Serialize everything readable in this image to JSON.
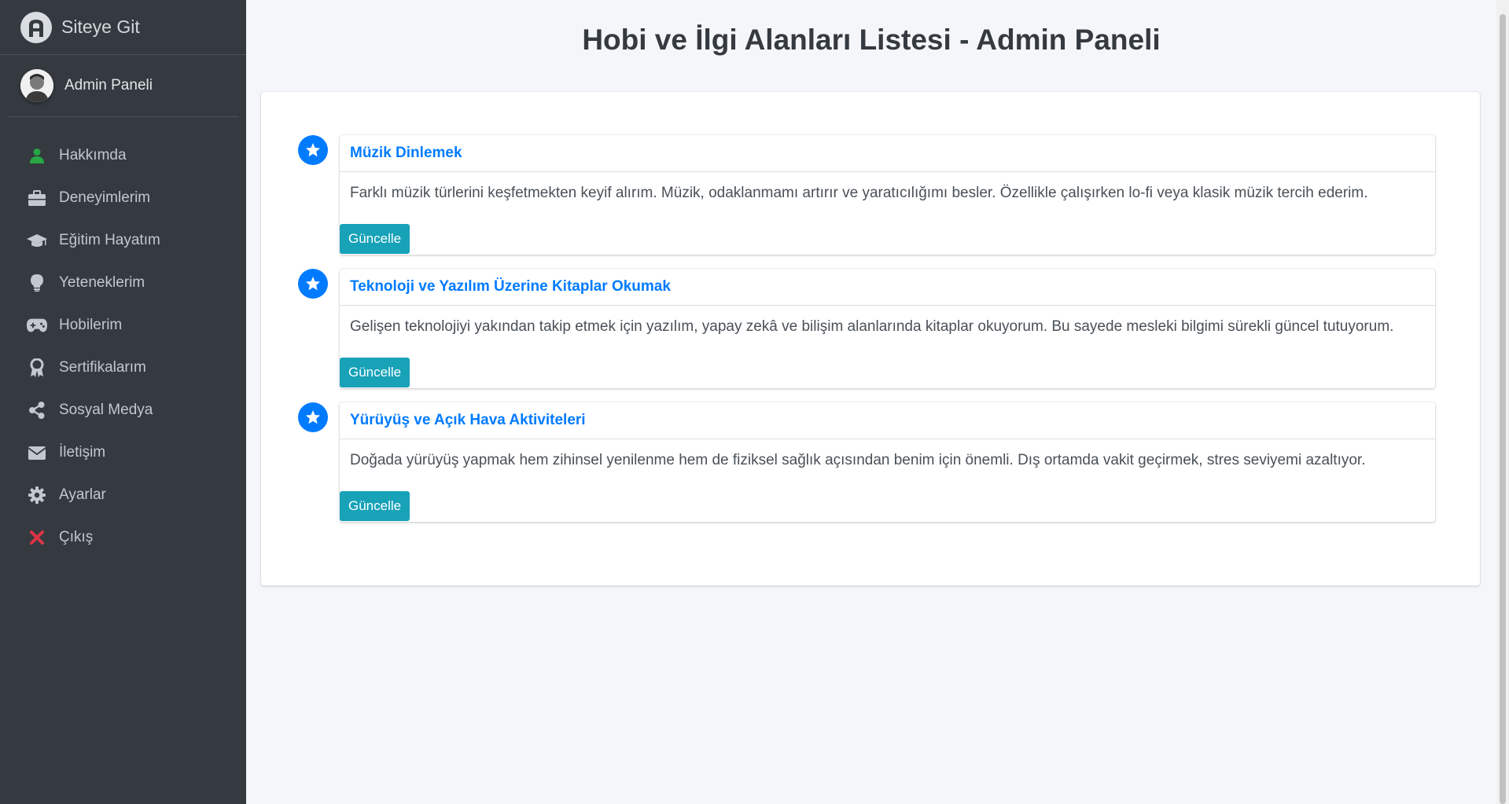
{
  "sidebar": {
    "brand": "Siteye Git",
    "user": "Admin Paneli",
    "items": [
      {
        "label": "Hakkımda",
        "icon": "user-icon",
        "color": "#28a745"
      },
      {
        "label": "Deneyimlerim",
        "icon": "briefcase-icon",
        "color": "#c2c7d0"
      },
      {
        "label": "Eğitim Hayatım",
        "icon": "graduation-cap-icon",
        "color": "#c2c7d0"
      },
      {
        "label": "Yeteneklerim",
        "icon": "lightbulb-icon",
        "color": "#c2c7d0"
      },
      {
        "label": "Hobilerim",
        "icon": "gamepad-icon",
        "color": "#c2c7d0"
      },
      {
        "label": "Sertifikalarım",
        "icon": "award-icon",
        "color": "#c2c7d0"
      },
      {
        "label": "Sosyal Medya",
        "icon": "share-icon",
        "color": "#c2c7d0"
      },
      {
        "label": "İletişim",
        "icon": "envelope-icon",
        "color": "#c2c7d0"
      },
      {
        "label": "Ayarlar",
        "icon": "gear-icon",
        "color": "#c2c7d0"
      },
      {
        "label": "Çıkış",
        "icon": "close-icon",
        "color": "#dc3545"
      }
    ]
  },
  "main": {
    "title": "Hobi ve İlgi Alanları Listesi - Admin Paneli",
    "hobbies": [
      {
        "title": "Müzik Dinlemek",
        "description": "Farklı müzik türlerini keşfetmekten keyif alırım. Müzik, odaklanmamı artırır ve yaratıcılığımı besler. Özellikle çalışırken lo-fi veya klasik müzik tercih ederim.",
        "button": "Güncelle"
      },
      {
        "title": "Teknoloji ve Yazılım Üzerine Kitaplar Okumak",
        "description": "Gelişen teknolojiyi yakından takip etmek için yazılım, yapay zekâ ve bilişim alanlarında kitaplar okuyorum. Bu sayede mesleki bilgimi sürekli güncel tutuyorum.",
        "button": "Güncelle"
      },
      {
        "title": "Yürüyüş ve Açık Hava Aktiviteleri",
        "description": "Doğada yürüyüş yapmak hem zihinsel yenilenme hem de fiziksel sağlık açısından benim için önemli. Dış ortamda vakit geçirmek, stres seviyemi azaltıyor.",
        "button": "Güncelle"
      }
    ]
  },
  "colors": {
    "accent": "#007bff",
    "button": "#17a2b8",
    "sidebar_bg": "#343a40",
    "logout": "#dc3545",
    "active_icon": "#28a745"
  }
}
